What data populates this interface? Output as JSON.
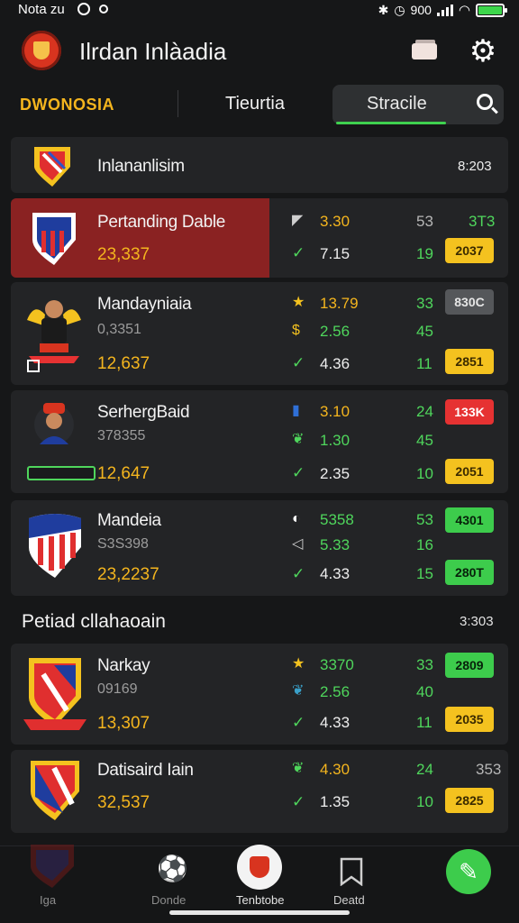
{
  "status_bar": {
    "time": "Nota zu",
    "right_text": "900"
  },
  "app": {
    "title": "Ilrdan Inlàadia"
  },
  "tabs": {
    "country": "DWONOSIA",
    "middle": "Tieurtia",
    "search_label": "Stracile"
  },
  "league_header": {
    "name": "Inlananlisim",
    "time": "8:203"
  },
  "matches": [
    {
      "team": "Pertanding Dable",
      "sub": "",
      "price": "23,337",
      "highlighted": true,
      "rows": [
        {
          "icon": "flag-icon",
          "value": "3.30",
          "value_color": "yellow",
          "count": "53",
          "count_color": "grey",
          "extra": "3T3",
          "extra_type": "text-green"
        },
        {
          "icon": "check-icon",
          "value": "7.15",
          "value_color": "white",
          "count": "19",
          "count_color": "green",
          "extra": "2037",
          "extra_type": "pill-yellow"
        }
      ]
    },
    {
      "team": "Mandayniaia",
      "sub": "0,3351",
      "price": "12,637",
      "highlighted": false,
      "rows": [
        {
          "icon": "star-icon",
          "value": "13.79",
          "value_color": "yellow",
          "count": "33",
          "count_color": "green",
          "extra": "830C",
          "extra_type": "pill-grey"
        },
        {
          "icon": "dollar-icon",
          "value": "2.56",
          "value_color": "green",
          "count": "45",
          "count_color": "green",
          "extra": "",
          "extra_type": ""
        },
        {
          "icon": "check-icon",
          "value": "4.36",
          "value_color": "white",
          "count": "11",
          "count_color": "green",
          "extra": "2851",
          "extra_type": "pill-yellow"
        }
      ]
    },
    {
      "team": "SerhergBaid",
      "sub": "378355",
      "price": "12,647",
      "highlighted": false,
      "rows": [
        {
          "icon": "bottle-icon",
          "value": "3.10",
          "value_color": "yellow",
          "count": "24",
          "count_color": "green",
          "extra": "133K",
          "extra_type": "pill-red"
        },
        {
          "icon": "leaf-icon",
          "value": "1.30",
          "value_color": "green",
          "count": "45",
          "count_color": "green",
          "extra": "",
          "extra_type": ""
        },
        {
          "icon": "check-icon",
          "value": "2.35",
          "value_color": "white",
          "count": "10",
          "count_color": "green",
          "extra": "2051",
          "extra_type": "pill-yellow"
        }
      ]
    },
    {
      "team": "Mandeia",
      "sub": "S3S398",
      "price": "23,2237",
      "highlighted": false,
      "rows": [
        {
          "icon": "moon-icon",
          "value": "5358",
          "value_color": "green",
          "count": "53",
          "count_color": "green",
          "extra": "4301",
          "extra_type": "pill-green"
        },
        {
          "icon": "flag-icon",
          "value": "5.33",
          "value_color": "green",
          "count": "16",
          "count_color": "green",
          "extra": "",
          "extra_type": ""
        },
        {
          "icon": "check-icon",
          "value": "4.33",
          "value_color": "white",
          "count": "15",
          "count_color": "green",
          "extra": "280T",
          "extra_type": "pill-green"
        }
      ]
    }
  ],
  "section": {
    "title": "Petiad cllahaoain",
    "time": "3:303"
  },
  "matches2": [
    {
      "team": "Narkay",
      "sub": "09169",
      "price": "13,307",
      "rows": [
        {
          "icon": "star-icon",
          "value": "3370",
          "value_color": "green",
          "count": "33",
          "count_color": "green",
          "extra": "2809",
          "extra_type": "pill-green"
        },
        {
          "icon": "leaf-icon",
          "value": "2.56",
          "value_color": "green",
          "count": "40",
          "count_color": "green",
          "extra": "",
          "extra_type": ""
        },
        {
          "icon": "check-icon",
          "value": "4.33",
          "value_color": "white",
          "count": "11",
          "count_color": "green",
          "extra": "2035",
          "extra_type": "pill-yellow"
        }
      ]
    },
    {
      "team": "Datisaird Iain",
      "sub": "",
      "price": "32,537",
      "rows": [
        {
          "icon": "leaf-icon",
          "value": "4.30",
          "value_color": "yellow",
          "count": "24",
          "count_color": "green",
          "extra": "353",
          "extra_type": "text-grey"
        },
        {
          "icon": "check-icon",
          "value": "1.35",
          "value_color": "white",
          "count": "10",
          "count_color": "green",
          "extra": "2825",
          "extra_type": "pill-yellow"
        }
      ]
    }
  ],
  "bottom_nav": {
    "items": [
      "Iga",
      "Donde",
      "Tenbtobe",
      "Deatd"
    ]
  },
  "colors": {
    "accent_green": "#3dcc4c",
    "accent_yellow": "#f4c21f",
    "accent_red": "#e63232",
    "highlight_row": "#8a2222"
  }
}
